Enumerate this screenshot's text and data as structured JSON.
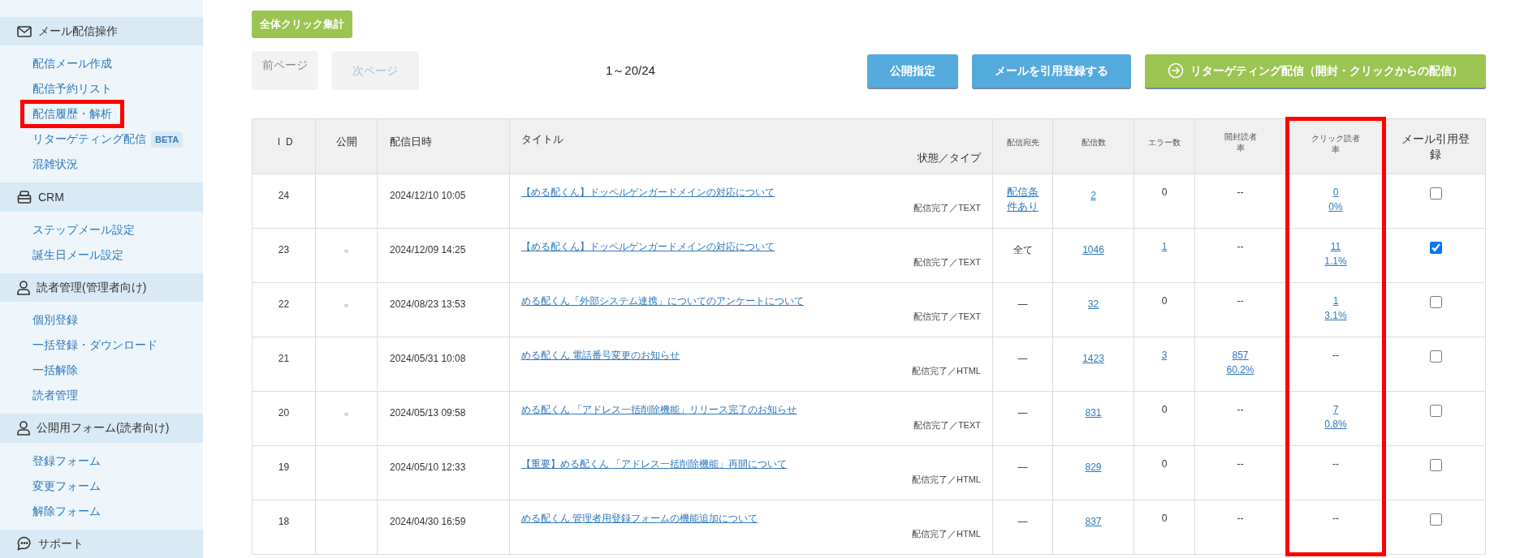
{
  "sidebar": {
    "sections": [
      {
        "label": "メール配信操作",
        "items": [
          {
            "label": "配信メール作成",
            "highlighted": false
          },
          {
            "label": "配信予約リスト",
            "highlighted": false
          },
          {
            "label": "配信履歴・解析",
            "highlighted": true
          },
          {
            "label": "リターゲティング配信",
            "badge": "BETA",
            "highlighted": false
          },
          {
            "label": "混雑状況",
            "highlighted": false
          }
        ]
      },
      {
        "label": "CRM",
        "items": [
          {
            "label": "ステップメール設定",
            "highlighted": false
          },
          {
            "label": "誕生日メール設定",
            "highlighted": false
          }
        ]
      },
      {
        "label": "読者管理(管理者向け)",
        "items": [
          {
            "label": "個別登録",
            "highlighted": false
          },
          {
            "label": "一括登録・ダウンロード",
            "highlighted": false
          },
          {
            "label": "一括解除",
            "highlighted": false
          },
          {
            "label": "読者管理",
            "highlighted": false
          }
        ]
      },
      {
        "label": "公開用フォーム(読者向け)",
        "items": [
          {
            "label": "登録フォーム",
            "highlighted": false
          },
          {
            "label": "変更フォーム",
            "highlighted": false
          },
          {
            "label": "解除フォーム",
            "highlighted": false
          }
        ]
      },
      {
        "label": "サポート"
      }
    ]
  },
  "toolbar": {
    "summary_button": "全体クリック集計",
    "prev_button": {
      "label": "前ページ",
      "disabled": true
    },
    "next_button": {
      "label": "次ページ",
      "disabled": true
    },
    "page_range": "1～20/24",
    "actions": [
      {
        "label": "公開指定",
        "kind": "blue"
      },
      {
        "label": "メールを引用登録する",
        "kind": "blue"
      },
      {
        "label": "リターゲティング配信（開封・クリックからの配信）",
        "kind": "green"
      }
    ]
  },
  "table": {
    "columns": [
      {
        "label": "ＩＤ",
        "highlighted": false
      },
      {
        "label": "公開",
        "highlighted": false
      },
      {
        "label": "配信日時",
        "highlighted": false
      },
      {
        "label": "タイトル",
        "sublabel": "状態／タイプ",
        "highlighted": false
      },
      {
        "label": "配信宛先",
        "highlighted": false
      },
      {
        "label": "配信数",
        "highlighted": false
      },
      {
        "label": "エラー数",
        "highlighted": false
      },
      {
        "label": "開封読者率",
        "highlighted": false
      },
      {
        "label": "クリック読者率",
        "highlighted": true
      },
      {
        "label": "メール引用登録",
        "highlighted": false
      }
    ],
    "rows": [
      {
        "id": "24",
        "date": "2024/12/10 10:05",
        "title": "【める配くん】ドッペルゲンガードメインの対応について",
        "status": "配信完了／TEXT",
        "recipient": {
          "text": "配信条件あり",
          "link": true
        },
        "sent": "2",
        "errors": {
          "lines": [
            "0"
          ],
          "link": false
        },
        "opens": {
          "lines": [
            "--"
          ],
          "link": false
        },
        "clicks": {
          "lines": [
            "0",
            "0%"
          ],
          "link": true
        },
        "checked": false
      },
      {
        "id": "23",
        "public": "○",
        "date": "2024/12/09 14:25",
        "title": "【める配くん】ドッペルゲンガードメインの対応について",
        "status": "配信完了／TEXT",
        "recipient": {
          "text": "全て",
          "link": false
        },
        "sent": "1046",
        "errors": {
          "lines": [
            "1"
          ],
          "link": true
        },
        "opens": {
          "lines": [
            "--"
          ],
          "link": false
        },
        "clicks": {
          "lines": [
            "11",
            "1.1%"
          ],
          "link": true
        },
        "checked": true
      },
      {
        "id": "22",
        "public": "○",
        "date": "2024/08/23 13:53",
        "title": "める配くん「外部システム連携」についてのアンケートについて",
        "status": "配信完了／TEXT",
        "recipient": {
          "text": "—",
          "link": false
        },
        "sent": "32",
        "errors": {
          "lines": [
            "0"
          ],
          "link": false
        },
        "opens": {
          "lines": [
            "--"
          ],
          "link": false
        },
        "clicks": {
          "lines": [
            "1",
            "3.1%"
          ],
          "link": true
        },
        "checked": false
      },
      {
        "id": "21",
        "date": "2024/05/31 10:08",
        "title": "める配くん 電話番号変更のお知らせ",
        "status": "配信完了／HTML",
        "recipient": {
          "text": "—",
          "link": false
        },
        "sent": "1423",
        "errors": {
          "lines": [
            "3"
          ],
          "link": true
        },
        "opens": {
          "lines": [
            "857",
            "60.2%"
          ],
          "link": true
        },
        "clicks": {
          "lines": [
            "--"
          ],
          "link": false
        },
        "checked": false
      },
      {
        "id": "20",
        "public": "○",
        "date": "2024/05/13 09:58",
        "title": "める配くん 「アドレス一括削除機能」リリース完了のお知らせ",
        "status": "配信完了／TEXT",
        "recipient": {
          "text": "—",
          "link": false
        },
        "sent": "831",
        "errors": {
          "lines": [
            "0"
          ],
          "link": false
        },
        "opens": {
          "lines": [
            "--"
          ],
          "link": false
        },
        "clicks": {
          "lines": [
            "7",
            "0.8%"
          ],
          "link": true
        },
        "checked": false
      },
      {
        "id": "19",
        "date": "2024/05/10 12:33",
        "title": "【重要】める配くん 「アドレス一括削除機能」再開について",
        "status": "配信完了／HTML",
        "recipient": {
          "text": "—",
          "link": false
        },
        "sent": "829",
        "errors": {
          "lines": [
            "0"
          ],
          "link": false
        },
        "opens": {
          "lines": [
            "--"
          ],
          "link": false
        },
        "clicks": {
          "lines": [
            "--"
          ],
          "link": false
        },
        "checked": false
      },
      {
        "id": "18",
        "date": "2024/04/30 16:59",
        "title": "める配くん 管理者用登録フォームの機能追加について",
        "status": "配信完了／HTML",
        "recipient": {
          "text": "—",
          "link": false
        },
        "sent": "837",
        "errors": {
          "lines": [
            "0"
          ],
          "link": false
        },
        "opens": {
          "lines": [
            "--"
          ],
          "link": false
        },
        "clicks": {
          "lines": [
            "--"
          ],
          "link": false
        },
        "checked": false
      }
    ]
  }
}
